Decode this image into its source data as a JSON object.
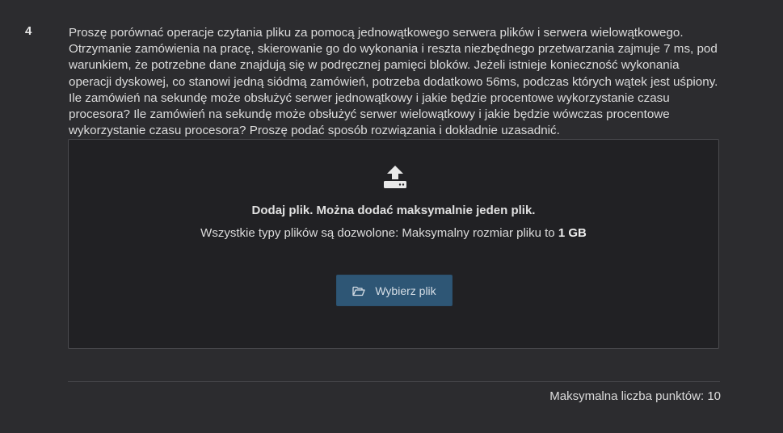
{
  "question": {
    "number": "4",
    "text": "Proszę porównać operacje czytania pliku za pomocą jednowątkowego serwera plików i serwera wielowątkowego. Otrzymanie zamówienia na pracę, skierowanie go do wykonania i reszta niezbędnego przetwarzania zajmuje 7 ms, pod warunkiem, że potrzebne dane znajdują się w podręcznej pamięci bloków. Jeżeli istnieje konieczność wykonania operacji dyskowej, co stanowi jedną siódmą zamówień, potrzeba dodatkowo 56ms, podczas których wątek jest uśpiony. Ile zamówień na sekundę może obsłużyć serwer jednowątkowy i jakie będzie procentowe wykorzystanie czasu procesora? Ile zamówień na sekundę może obsłużyć serwer wielowątkowy i jakie będzie wówczas procentowe wykorzystanie czasu procesora?  Proszę podać sposób rozwiązania i dokładnie uzasadnić."
  },
  "upload": {
    "icon": "upload-icon",
    "title": "Dodaj plik. Można dodać maksymalnie jeden plik.",
    "info_prefix": "Wszystkie typy plików są dozwolone: Maksymalny rozmiar pliku to ",
    "max_size": "1 GB",
    "button_label": "Wybierz plik",
    "button_icon": "folder-open-icon",
    "button_color": "#2e5675"
  },
  "footer": {
    "max_points": "Maksymalna liczba punktów: 10"
  }
}
